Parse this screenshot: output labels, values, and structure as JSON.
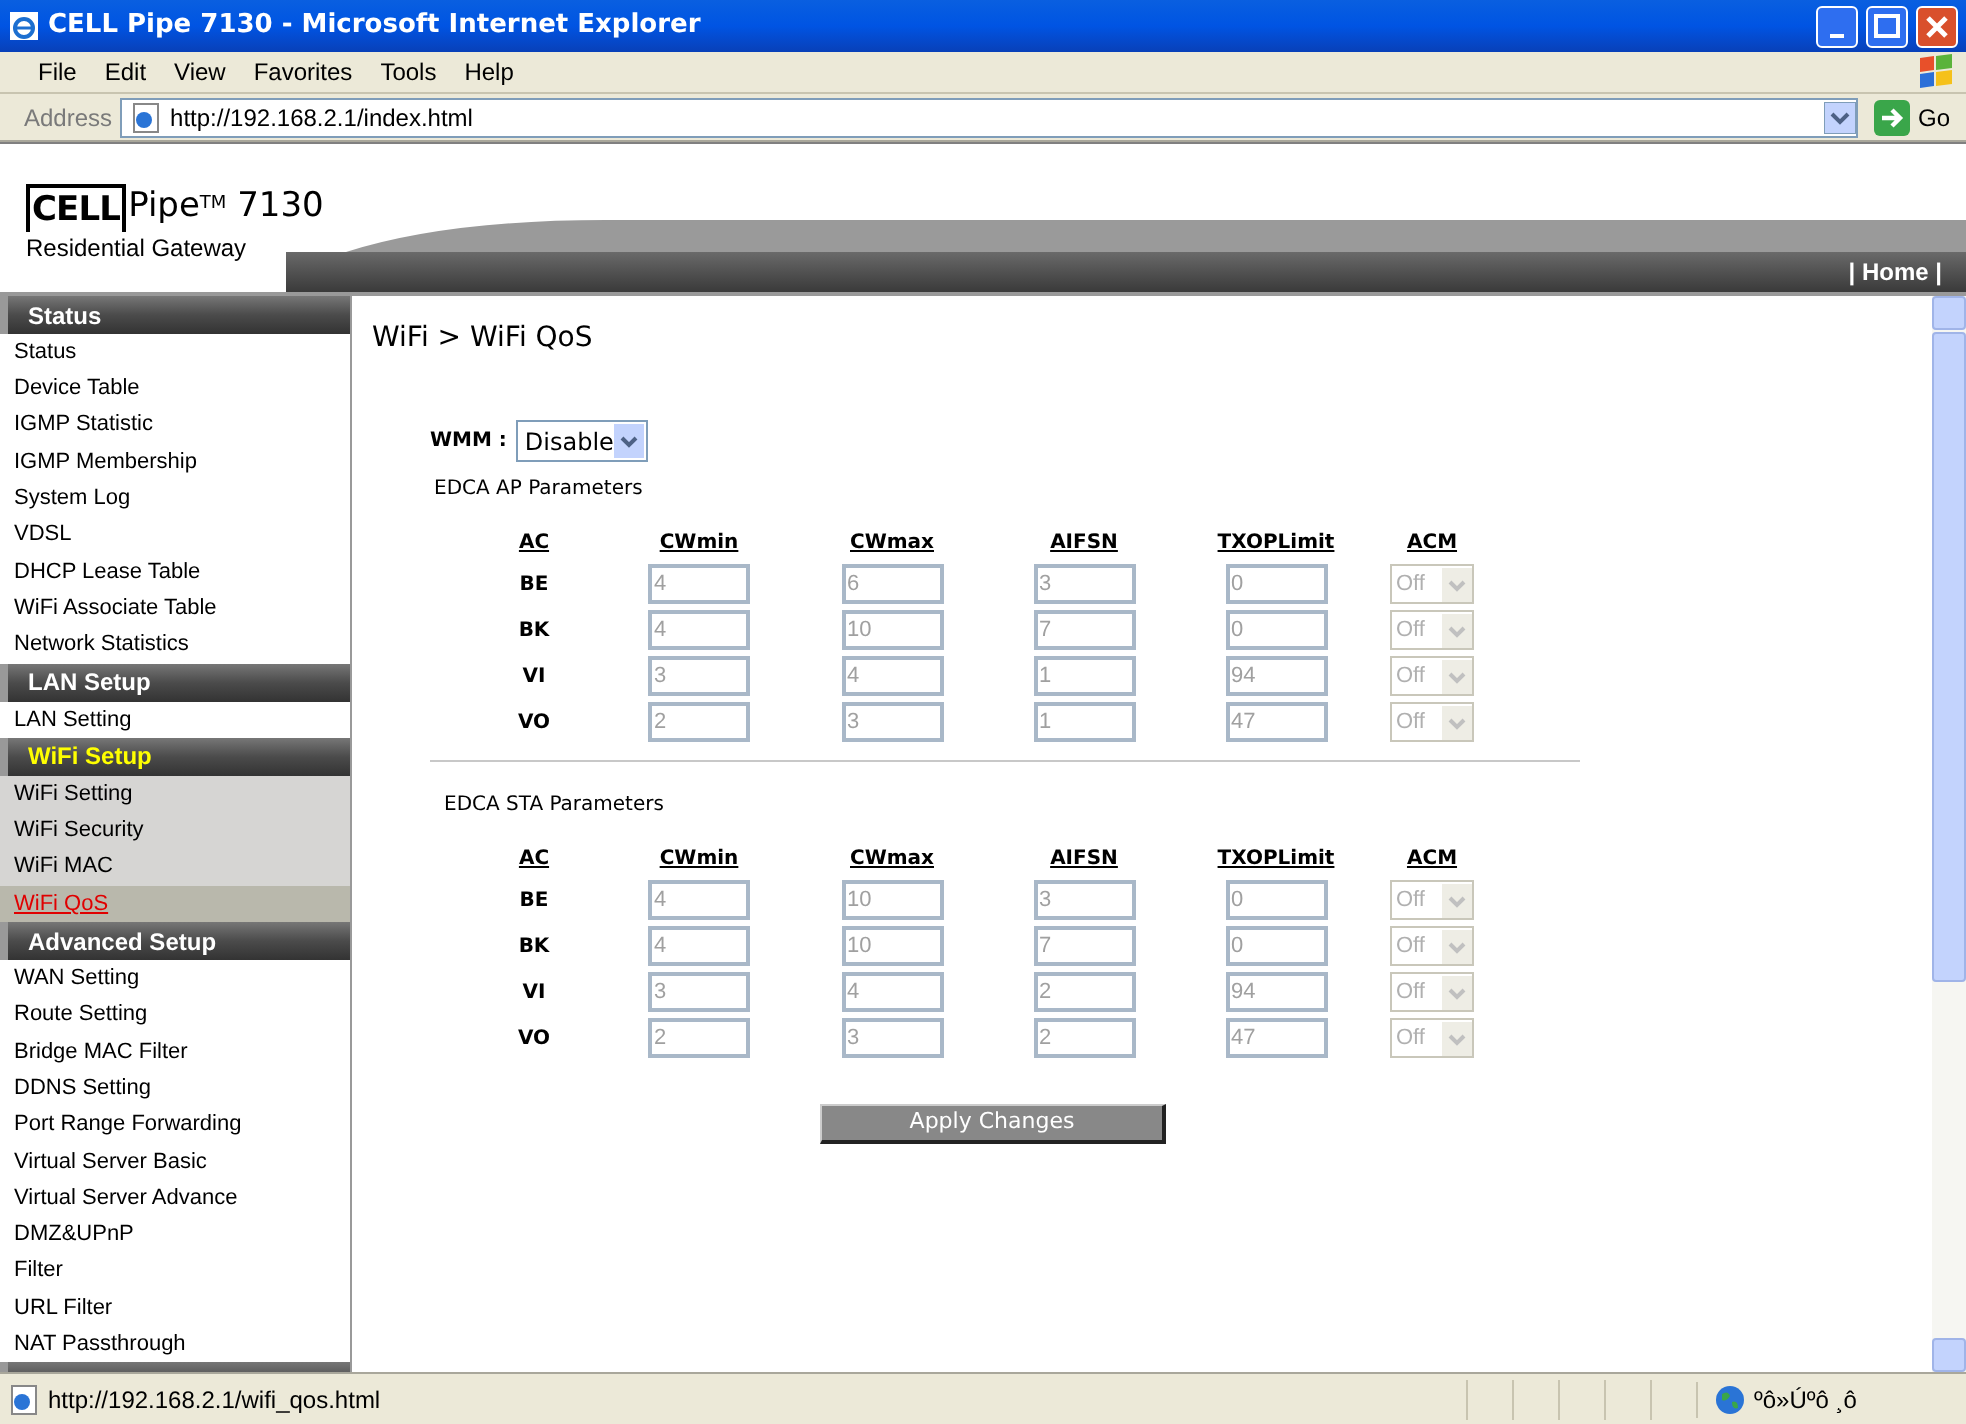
{
  "window": {
    "title": "CELL Pipe 7130 - Microsoft Internet Explorer"
  },
  "menu": [
    "File",
    "Edit",
    "View",
    "Favorites",
    "Tools",
    "Help"
  ],
  "address_bar": {
    "label": "Address",
    "value": "http://192.168.2.1/index.html",
    "go": "Go"
  },
  "logo": {
    "boxed": "CELL",
    "name": "Pipe$^{TM}$ 7130",
    "tagline": "Residential Gateway"
  },
  "header_link": "| Home |",
  "sidebar": [
    {
      "title": "Status",
      "active": false,
      "items": [
        {
          "label": "Status",
          "selected": false
        },
        {
          "label": "Device Table",
          "selected": false
        },
        {
          "label": "IGMP Statistic",
          "selected": false
        },
        {
          "label": "IGMP Membership",
          "selected": false
        },
        {
          "label": "System Log",
          "selected": false
        },
        {
          "label": "VDSL",
          "selected": false
        },
        {
          "label": "DHCP Lease Table",
          "selected": false
        },
        {
          "label": "WiFi Associate Table",
          "selected": false
        },
        {
          "label": "Network Statistics",
          "selected": false
        }
      ]
    },
    {
      "title": "LAN Setup",
      "active": false,
      "items": [
        {
          "label": "LAN Setting",
          "selected": false
        }
      ]
    },
    {
      "title": "WiFi Setup",
      "active": true,
      "items": [
        {
          "label": "WiFi Setting",
          "selected": false
        },
        {
          "label": "WiFi Security",
          "selected": false
        },
        {
          "label": "WiFi MAC",
          "selected": false
        },
        {
          "label": "WiFi QoS",
          "selected": true
        }
      ]
    },
    {
      "title": "Advanced Setup",
      "active": false,
      "items": [
        {
          "label": "WAN Setting",
          "selected": false
        },
        {
          "label": "Route Setting",
          "selected": false
        },
        {
          "label": "Bridge MAC Filter",
          "selected": false
        },
        {
          "label": "DDNS Setting",
          "selected": false
        },
        {
          "label": "Port Range Forwarding",
          "selected": false
        },
        {
          "label": "Virtual Server Basic",
          "selected": false
        },
        {
          "label": "Virtual Server Advance",
          "selected": false
        },
        {
          "label": "DMZ&UPnP",
          "selected": false
        },
        {
          "label": "Filter",
          "selected": false
        },
        {
          "label": "URL Filter",
          "selected": false
        },
        {
          "label": "NAT Passthrough",
          "selected": false
        }
      ]
    }
  ],
  "page_title": "WiFi > WiFi QoS",
  "wmm": {
    "label": "WMM :",
    "value": "Disable"
  },
  "parameter_sections": [
    {
      "title": "EDCA AP Parameters",
      "disabled": true,
      "columns": [
        "AC",
        "CWmin",
        "CWmax",
        "AIFSN",
        "TXOPLimit",
        "ACM"
      ],
      "rows": [
        {
          "ac": "BE",
          "cwmin": "4",
          "cwmax": "6",
          "aifsn": "3",
          "txop_limit": "0",
          "acm": "Off"
        },
        {
          "ac": "BK",
          "cwmin": "4",
          "cwmax": "10",
          "aifsn": "7",
          "txop_limit": "0",
          "acm": "Off"
        },
        {
          "ac": "VI",
          "cwmin": "3",
          "cwmax": "4",
          "aifsn": "1",
          "txop_limit": "94",
          "acm": "Off"
        },
        {
          "ac": "VO",
          "cwmin": "2",
          "cwmax": "3",
          "aifsn": "1",
          "txop_limit": "47",
          "acm": "Off"
        }
      ]
    },
    {
      "title": "EDCA STA Parameters",
      "disabled": true,
      "columns": [
        "AC",
        "CWmin",
        "CWmax",
        "AIFSN",
        "TXOPLimit",
        "ACM"
      ],
      "rows": [
        {
          "ac": "BE",
          "cwmin": "4",
          "cwmax": "10",
          "aifsn": "3",
          "txop_limit": "0",
          "acm": "Off"
        },
        {
          "ac": "BK",
          "cwmin": "4",
          "cwmax": "10",
          "aifsn": "7",
          "txop_limit": "0",
          "acm": "Off"
        },
        {
          "ac": "VI",
          "cwmin": "3",
          "cwmax": "4",
          "aifsn": "2",
          "txop_limit": "94",
          "acm": "Off"
        },
        {
          "ac": "VO",
          "cwmin": "2",
          "cwmax": "3",
          "aifsn": "2",
          "txop_limit": "47",
          "acm": "Off"
        }
      ]
    }
  ],
  "apply_button": "Apply Changes",
  "status_bar": {
    "url": "http://192.168.2.1/wifi_qos.html",
    "zone": "ºô»Úºô ¸ô"
  }
}
